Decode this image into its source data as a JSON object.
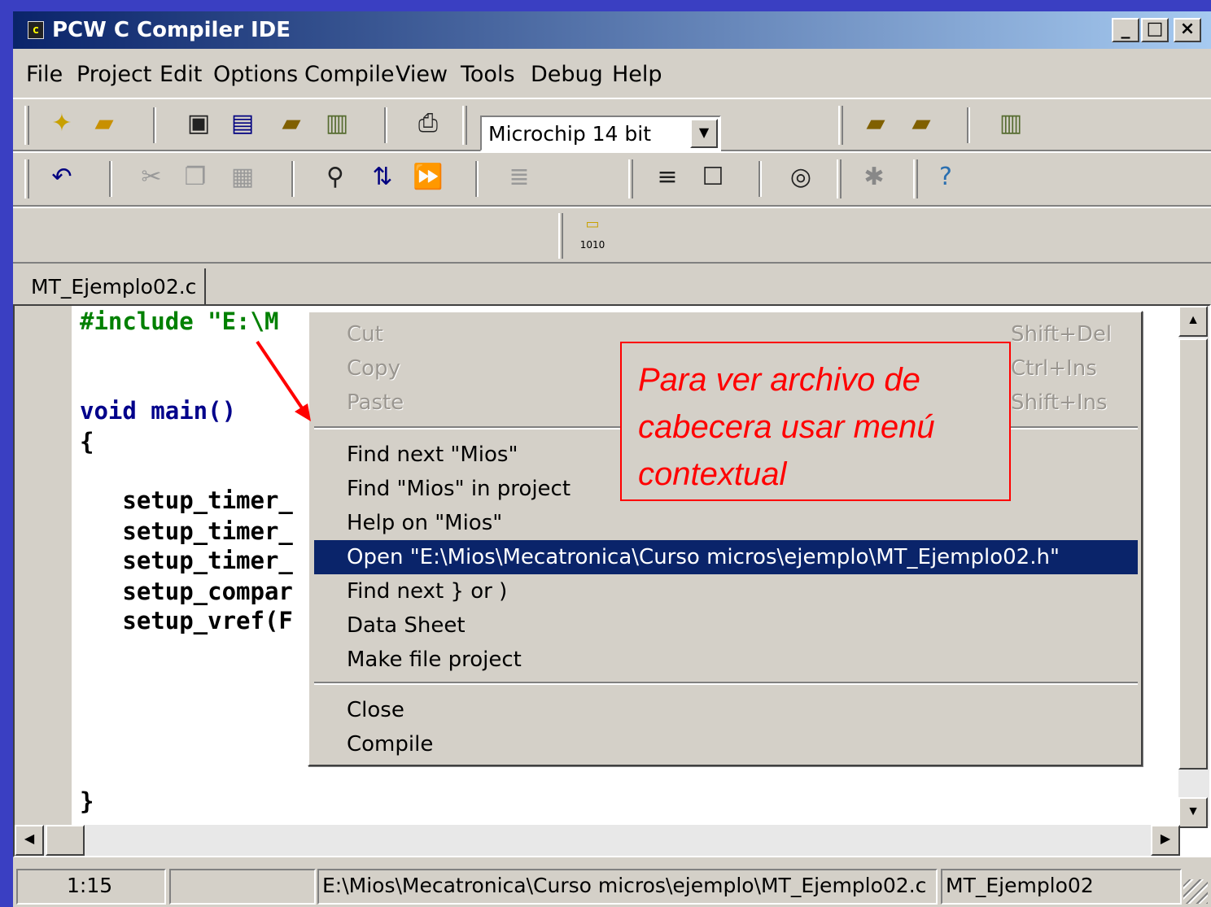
{
  "window": {
    "title": "PCW C Compiler IDE",
    "icon_label": "c"
  },
  "caption_buttons": {
    "minimize": "_",
    "maximize": "□",
    "close": "×"
  },
  "menubar": [
    "File",
    "Project",
    "Edit",
    "Options",
    "Compile",
    "View",
    "Tools",
    "Debug",
    "Help"
  ],
  "toolbar": {
    "device_select": "Microchip 14 bit",
    "icons": [
      "new-file-icon",
      "open-folder-icon",
      "save-icon",
      "save-all-icon",
      "open-project-icon",
      "file-icon",
      "print-icon",
      "undo-icon",
      "cut-icon",
      "copy-icon",
      "paste-icon",
      "find-icon",
      "replace-icon",
      "find-next-icon",
      "indent-icon",
      "format-icon",
      "comment-icon",
      "cd-icon",
      "bug-icon",
      "help-icon",
      "compile-icon"
    ]
  },
  "tab": {
    "label": "MT_Ejemplo02.c"
  },
  "editor": {
    "lines": [
      {
        "text": "#include \"E:\\M",
        "style": "green"
      },
      {
        "text": "void main()",
        "style": "blue"
      },
      {
        "text": "{",
        "style": "black"
      },
      {
        "text": "   setup_timer_",
        "style": "black"
      },
      {
        "text": "   setup_timer_",
        "style": "black"
      },
      {
        "text": "   setup_timer_",
        "style": "black"
      },
      {
        "text": "   setup_compar",
        "style": "black"
      },
      {
        "text": "   setup_vref(F",
        "style": "black"
      },
      {
        "text": "}",
        "style": "black"
      }
    ]
  },
  "context_menu": {
    "cut": {
      "label": "Cut",
      "shortcut": "Shift+Del"
    },
    "copy": {
      "label": "Copy",
      "shortcut": "Ctrl+Ins"
    },
    "paste": {
      "label": "Paste",
      "shortcut": "Shift+Ins"
    },
    "find_next": "Find next \"Mios\"",
    "find_in_project": "Find \"Mios\" in project",
    "help_on": "Help on \"Mios\"",
    "open": "Open \"E:\\Mios\\Mecatronica\\Curso micros\\ejemplo\\MT_Ejemplo02.h\"",
    "find_brace": "Find next } or )",
    "data_sheet": "Data Sheet",
    "make_file": "Make file project",
    "close": "Close",
    "compile": "Compile"
  },
  "annotation": {
    "text": "Para ver archivo de cabecera usar menú contextual",
    "color": "#ff0000"
  },
  "statusbar": {
    "position": "1:15",
    "blank": "",
    "path": "E:\\Mios\\Mecatronica\\Curso micros\\ejemplo\\MT_Ejemplo02.c",
    "project": "MT_Ejemplo02"
  },
  "colors": {
    "desktop": "#3a3fc2",
    "highlight": "#0a246a",
    "face": "#d4d0c8"
  }
}
